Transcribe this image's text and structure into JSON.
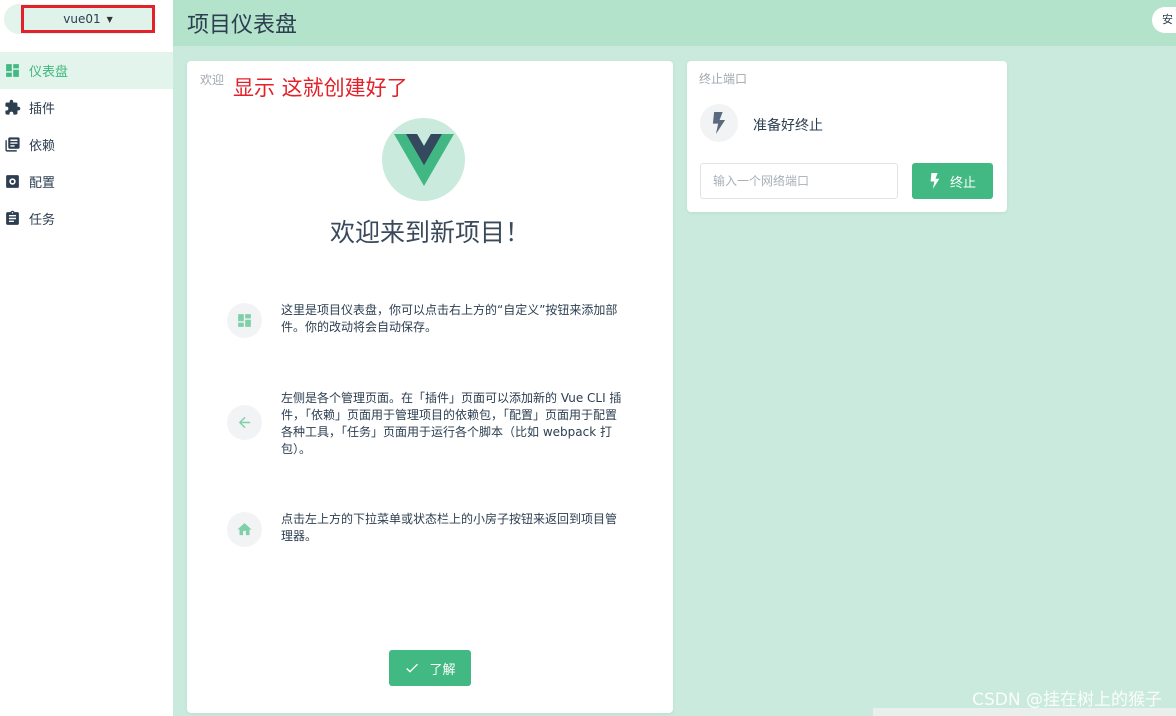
{
  "project": {
    "name": "vue01"
  },
  "sidebar": {
    "items": [
      {
        "label": "仪表盘",
        "icon": "dashboard-icon",
        "active": true
      },
      {
        "label": "插件",
        "icon": "puzzle-icon",
        "active": false
      },
      {
        "label": "依赖",
        "icon": "library-books-icon",
        "active": false
      },
      {
        "label": "配置",
        "icon": "settings-icon",
        "active": false
      },
      {
        "label": "任务",
        "icon": "assignment-icon",
        "active": false
      }
    ]
  },
  "header": {
    "title": "项目仪表盘",
    "customize_label": "安"
  },
  "welcome": {
    "tag": "欢迎",
    "annotation": "显示  这就创建好了",
    "title": "欢迎来到新项目！",
    "tips": [
      {
        "icon": "dashboard-icon",
        "text": "这里是项目仪表盘，你可以点击右上方的“自定义”按钮来添加部件。你的改动将会自动保存。"
      },
      {
        "icon": "arrow-left-icon",
        "text": "左侧是各个管理页面。在「插件」页面可以添加新的 Vue CLI 插件，「依赖」页面用于管理项目的依赖包，「配置」页面用于配置各种工具，「任务」页面用于运行各个脚本（比如 webpack 打包）。"
      },
      {
        "icon": "home-icon",
        "text": "点击左上方的下拉菜单或状态栏上的小房子按钮来返回到项目管理器。"
      }
    ],
    "ok_label": "了解"
  },
  "kill_port": {
    "tag": "终止端口",
    "status": "准备好终止",
    "input_placeholder": "输入一个网络端口",
    "button_label": "终止"
  },
  "watermark": "CSDN @挂在树上的猴子",
  "colors": {
    "accent": "#42b983",
    "sidebar_active_bg": "#e3f4ec",
    "page_bg": "#c9eadd",
    "topbar_bg": "#b4e3cc",
    "annotation": "#e3212b"
  }
}
